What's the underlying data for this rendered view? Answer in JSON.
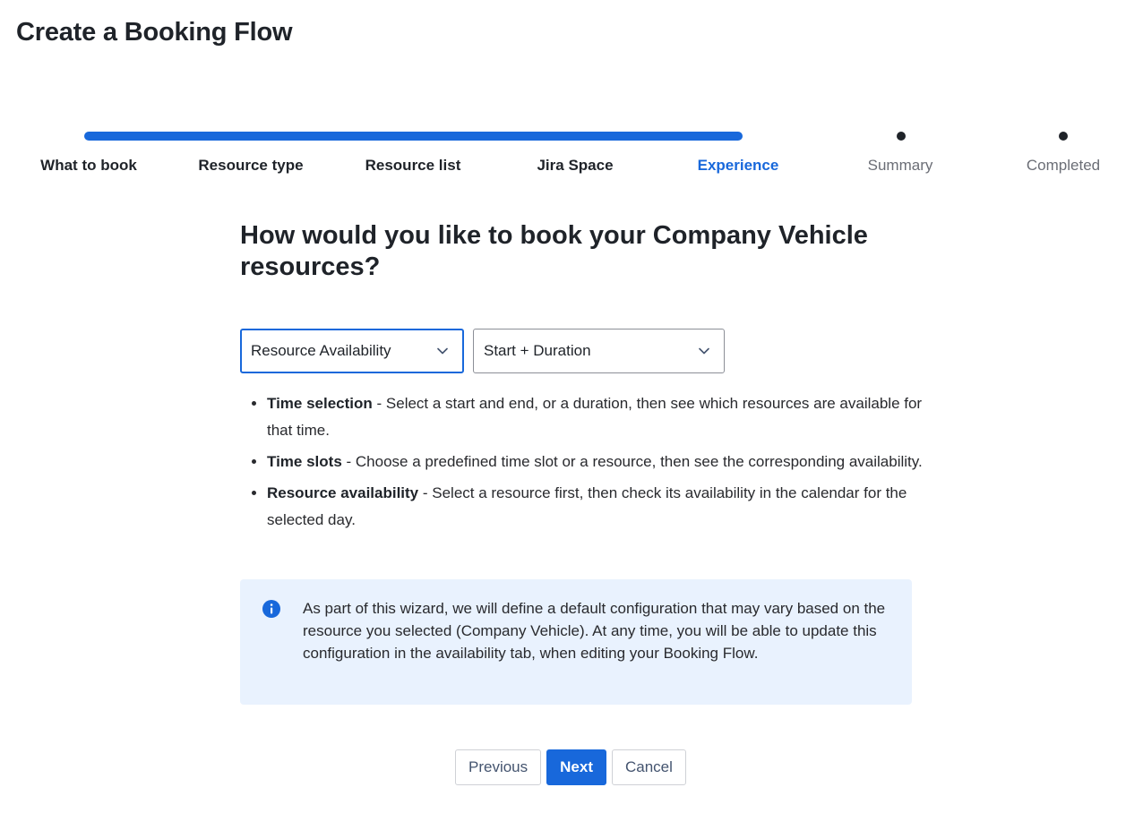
{
  "page": {
    "title": "Create a Booking Flow"
  },
  "stepper": {
    "progress_percent": 62,
    "steps": [
      {
        "label": "What to book",
        "state": "done"
      },
      {
        "label": "Resource type",
        "state": "done"
      },
      {
        "label": "Resource list",
        "state": "done"
      },
      {
        "label": "Jira Space",
        "state": "done"
      },
      {
        "label": "Experience",
        "state": "current"
      },
      {
        "label": "Summary",
        "state": "todo"
      },
      {
        "label": "Completed",
        "state": "todo"
      }
    ]
  },
  "main": {
    "question": "How would you like to book your Company Vehicle resources?",
    "select_mode": {
      "value": "Resource Availability"
    },
    "select_time": {
      "value": "Start + Duration"
    },
    "options": [
      {
        "title": "Time selection",
        "description": " - Select a start and end, or a duration, then see which resources are available for that time."
      },
      {
        "title": "Time slots",
        "description": " - Choose a predefined time slot or a resource, then see the corresponding availability."
      },
      {
        "title": "Resource availability",
        "description": " - Select a resource first, then check its availability in the calendar for the selected day."
      }
    ],
    "info_message": "As part of this wizard, we will define a default configuration that may vary based on the resource you selected (Company Vehicle). At any time, you will be able to update this configuration in the availability tab, when editing your Booking Flow."
  },
  "actions": {
    "previous_label": "Previous",
    "next_label": "Next",
    "cancel_label": "Cancel"
  },
  "colors": {
    "accent": "#1868db",
    "info_background": "#e9f2fe",
    "text_primary": "#1f2329",
    "text_muted": "#6b6e76"
  },
  "icons": {
    "select_chevron": "chevron-down-icon",
    "info": "info-icon"
  }
}
